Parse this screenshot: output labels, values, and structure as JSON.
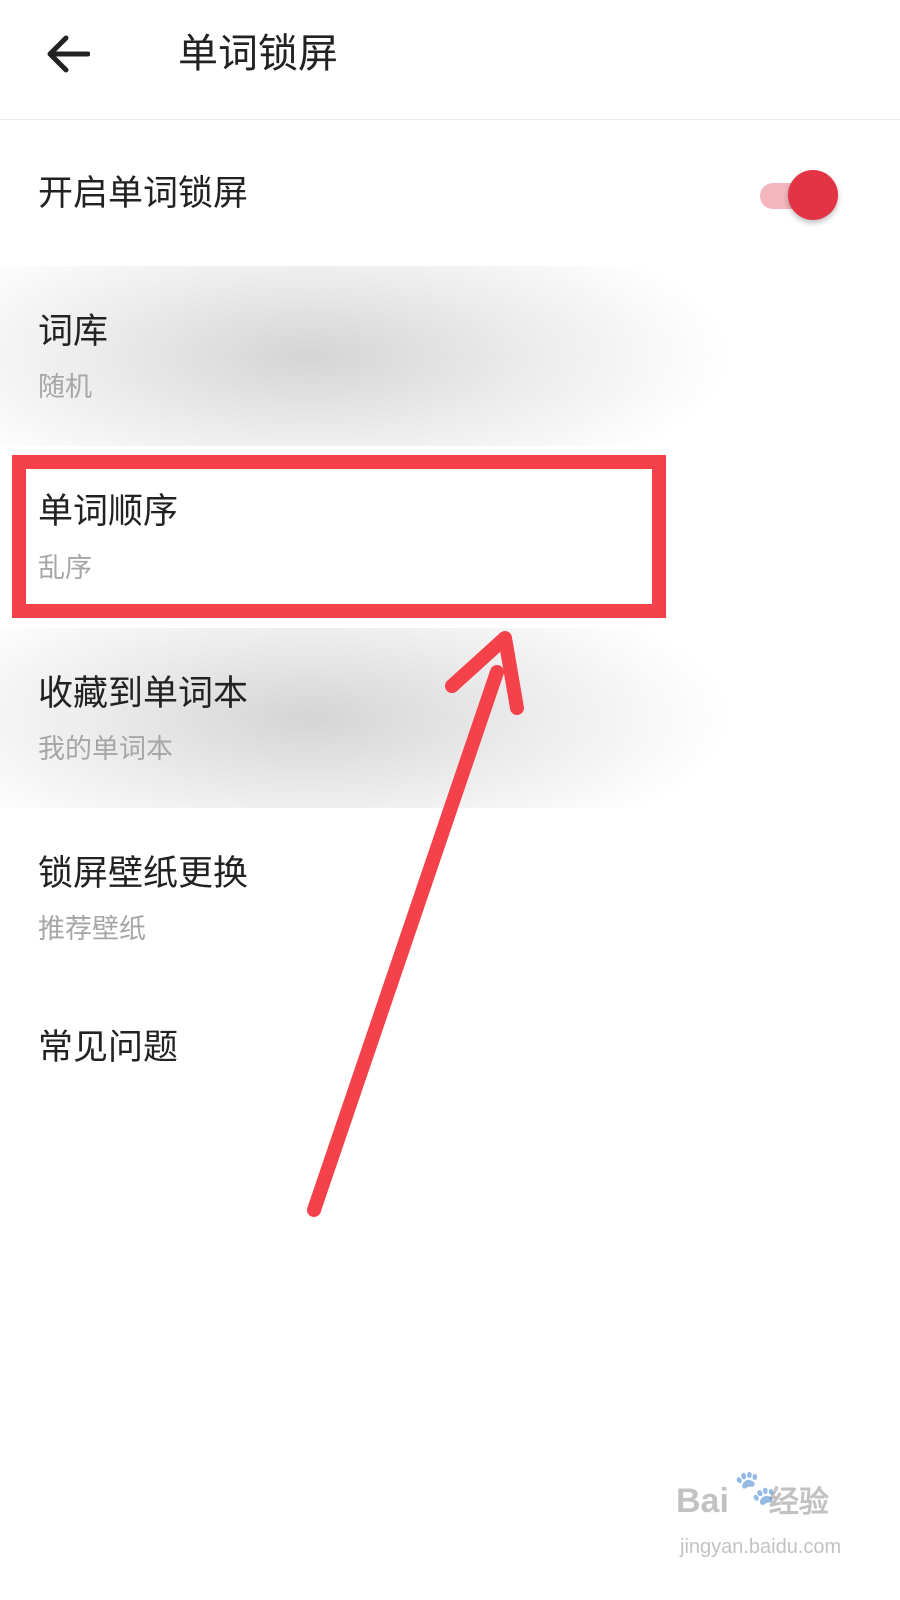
{
  "header": {
    "title": "单词锁屏",
    "back_icon": "back-arrow-icon"
  },
  "settings": {
    "lockscreen_toggle": {
      "label": "开启单词锁屏",
      "enabled": true,
      "accent": "#e23445"
    },
    "items": [
      {
        "title": "词库",
        "value": "随机"
      },
      {
        "title": "单词顺序",
        "value": "乱序"
      },
      {
        "title": "收藏到单词本",
        "value": "我的单词本"
      },
      {
        "title": "锁屏壁纸更换",
        "value": "推荐壁纸"
      },
      {
        "title": "常见问题"
      }
    ]
  },
  "annotation": {
    "color": "#f4414a"
  },
  "watermark": {
    "brand": "Bai",
    "brand_cn": "经验",
    "site": "jingyan.baidu.com",
    "icon": "paw-icon"
  }
}
